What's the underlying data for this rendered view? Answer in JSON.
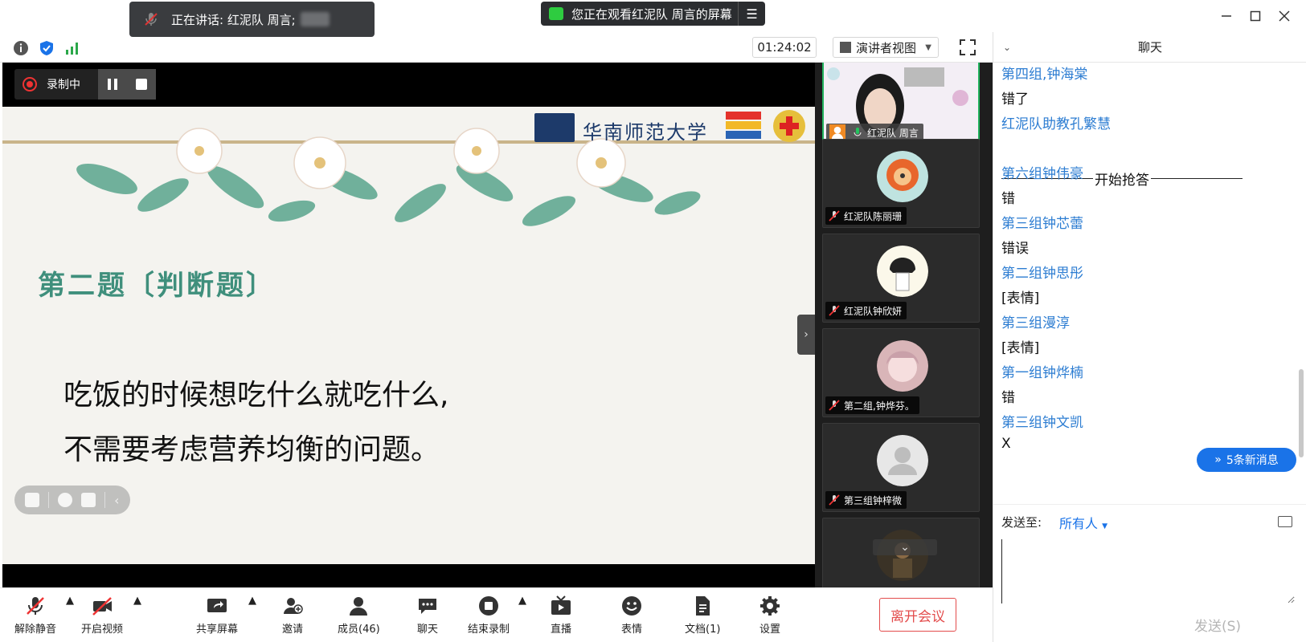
{
  "top": {
    "speaking_label": "正在讲话: 红泥队 周言;",
    "watching_label": "您正在观看红泥队 周言的屏幕",
    "timer": "01:24:02",
    "view_mode": "演讲者视图"
  },
  "recording": {
    "label": "录制中"
  },
  "slide": {
    "title": "第二题〔判断题〕",
    "line1": "吃饭的时候想吃什么就吃什么,",
    "line2": "不需要考虑营养均衡的问题。",
    "logo_text": "华南师范大学"
  },
  "gallery": {
    "tiles": [
      {
        "name": "红泥队 周言"
      },
      {
        "name": "红泥队陈丽珊"
      },
      {
        "name": "红泥队钟欣妍"
      },
      {
        "name": "第二组,钟烨芬。"
      },
      {
        "name": "第三组钟梓微"
      }
    ]
  },
  "chat": {
    "title": "聊天",
    "divider_text": "开始抢答",
    "messages": [
      {
        "text": "第四组,钟海棠",
        "kind": "sender"
      },
      {
        "text": "错了",
        "kind": "text"
      },
      {
        "text": "红泥队助教孔繁慧",
        "kind": "sender"
      },
      {
        "text": "第六组钟伟豪",
        "kind": "sender"
      },
      {
        "text": "错",
        "kind": "text"
      },
      {
        "text": "第三组钟芯蕾",
        "kind": "sender"
      },
      {
        "text": "错误",
        "kind": "text"
      },
      {
        "text": "第二组钟思彤",
        "kind": "sender"
      },
      {
        "text": "[表情]",
        "kind": "text"
      },
      {
        "text": "第三组漫淳",
        "kind": "sender"
      },
      {
        "text": "[表情]",
        "kind": "text"
      },
      {
        "text": "第一组钟烨楠",
        "kind": "sender"
      },
      {
        "text": "错",
        "kind": "text"
      },
      {
        "text": "第三组钟文凯",
        "kind": "sender"
      },
      {
        "text": "X",
        "kind": "text"
      }
    ],
    "new_messages": "5条新消息",
    "send_to_label": "发送至:",
    "send_to_value": "所有人",
    "send_button": "发送(S)"
  },
  "toolbar": {
    "unmute": "解除静音",
    "start_video": "开启视频",
    "share_screen": "共享屏幕",
    "invite": "邀请",
    "members": "成员(46)",
    "chat": "聊天",
    "end_recording": "结束录制",
    "live": "直播",
    "emoji": "表情",
    "docs": "文档(1)",
    "settings": "设置",
    "leave": "离开会议"
  },
  "colors": {
    "accent_blue": "#1a73e8",
    "sender_blue": "#2d7dd2",
    "leave_red": "#e34c4c",
    "active_green": "#22b35e",
    "slide_title_green": "#3f8f7c"
  }
}
